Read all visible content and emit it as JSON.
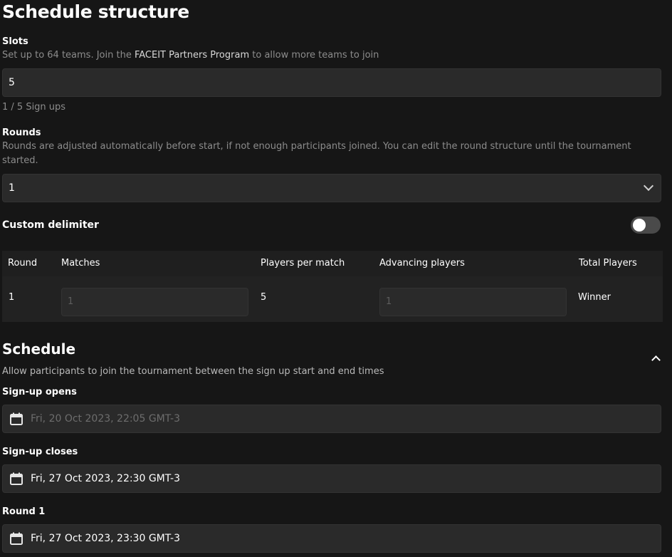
{
  "schedule_structure": {
    "title": "Schedule structure",
    "slots": {
      "label": "Slots",
      "help_prefix": "Set up to 64 teams. Join the ",
      "help_link": "FACEIT Partners Program",
      "help_suffix": " to allow more teams to join",
      "value": "5",
      "signups": "1 / 5 Sign ups"
    },
    "rounds": {
      "label": "Rounds",
      "help": "Rounds are adjusted automatically before start, if not enough participants joined. You can edit the round structure until the tournament started.",
      "value": "1"
    },
    "custom_delimiter": {
      "label": "Custom delimiter",
      "enabled": false
    },
    "table": {
      "headers": [
        "Round",
        "Matches",
        "Players per match",
        "Advancing players",
        "Total Players"
      ],
      "rows": [
        {
          "round": "1",
          "matches": "1",
          "players_per_match": "5",
          "advancing_players": "1",
          "total_players": "Winner"
        }
      ]
    }
  },
  "schedule": {
    "title": "Schedule",
    "help": "Allow participants to join the tournament between the sign up start and end times",
    "signup_opens": {
      "label": "Sign-up opens",
      "value": "Fri, 20 Oct 2023, 22:05 GMT-3"
    },
    "signup_closes": {
      "label": "Sign-up closes",
      "value": "Fri, 27 Oct 2023, 22:30 GMT-3"
    },
    "round_1": {
      "label": "Round 1",
      "value": "Fri, 27 Oct 2023, 23:30 GMT-3"
    }
  },
  "icons": {
    "dropdown": "chevron-down-icon",
    "collapse": "chevron-up-icon",
    "calendar": "calendar-icon"
  }
}
